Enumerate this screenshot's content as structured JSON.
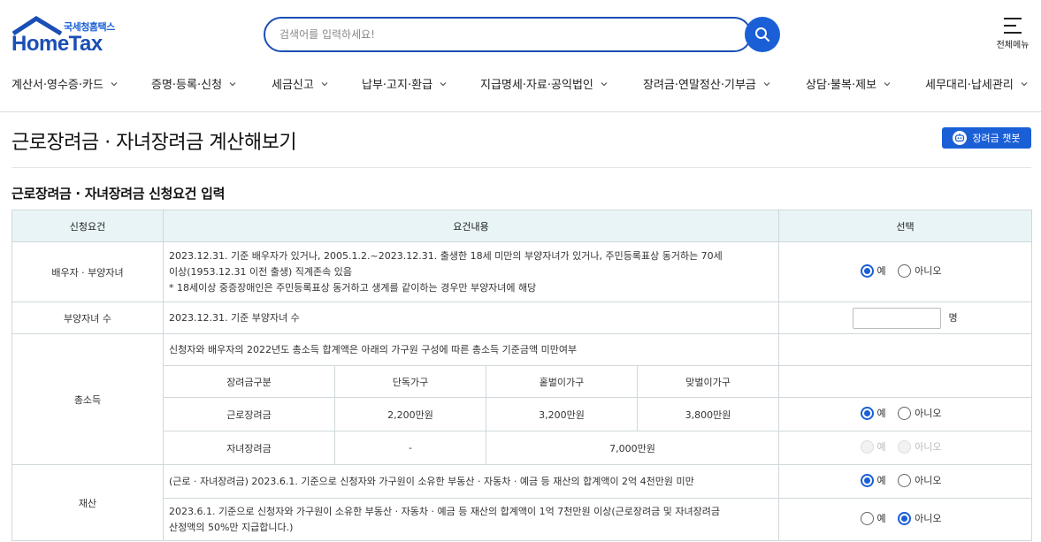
{
  "header": {
    "logo_sub": "국세청홈택스",
    "logo_main": "HomeTax",
    "search_placeholder": "검색어를 입력하세요!",
    "menu_label": "전체메뉴"
  },
  "nav": [
    {
      "label": "계산서·영수증·카드"
    },
    {
      "label": "증명·등록·신청"
    },
    {
      "label": "세금신고"
    },
    {
      "label": "납부·고지·환급"
    },
    {
      "label": "지급명세·자료·공익법인"
    },
    {
      "label": "장려금·연말정산·기부금"
    },
    {
      "label": "상담·불복·제보"
    },
    {
      "label": "세무대리·납세관리"
    }
  ],
  "page": {
    "title": "근로장려금 · 자녀장려금 계산해보기",
    "chatbot_label": "장려금 챗봇",
    "section_title": "근로장려금 · 자녀장려금 신청요건 입력"
  },
  "table": {
    "headers": [
      "신청요건",
      "요건내용",
      "선택"
    ],
    "spouse": {
      "label": "배우자 · 부양자녀",
      "line1": "2023.12.31. 기준 배우자가 있거나, 2005.1.2.~2023.12.31. 출생한 18세 미만의 부양자녀가 있거나, 주민등록표상 동거하는 70세",
      "line2": "이상(1953.12.31 이전 출생) 직계존속 있음",
      "line3": "* 18세이상 중증장애인은 주민등록표상 동거하고 생계를 같이하는 경우만 부양자녀에 해당",
      "yes": "예",
      "no": "아니오"
    },
    "children": {
      "label": "부양자녀 수",
      "content": "2023.12.31. 기준 부양자녀 수",
      "unit": "명"
    },
    "income": {
      "label": "총소득",
      "content": "신청자와 배우자의 2022년도 총소득 합계액은 아래의 가구원 구성에 따른 총소득 기준금액 미만여부",
      "sub_headers": [
        "장려금구분",
        "단독가구",
        "홑벌이가구",
        "맞벌이가구"
      ],
      "row1": [
        "근로장려금",
        "2,200만원",
        "3,200만원",
        "3,800만원"
      ],
      "row2": [
        "자녀장려금",
        "-",
        "7,000만원"
      ],
      "yes": "예",
      "no": "아니오"
    },
    "assets": {
      "label": "재산",
      "row1": "(근로 · 자녀장려금) 2023.6.1. 기준으로 신청자와 가구원이 소유한 부동산 · 자동차 · 예금 등 재산의 합계액이 2억 4천만원 미만",
      "row2_line1": "2023.6.1. 기준으로 신청자와 가구원이 소유한 부동산 · 자동차 · 예금 등 재산의 합계액이 1억 7천만원 이상(근로장려금 및 자녀장려금",
      "row2_line2": "산정액의 50%만 지급합니다.)",
      "yes": "예",
      "no": "아니오"
    }
  }
}
